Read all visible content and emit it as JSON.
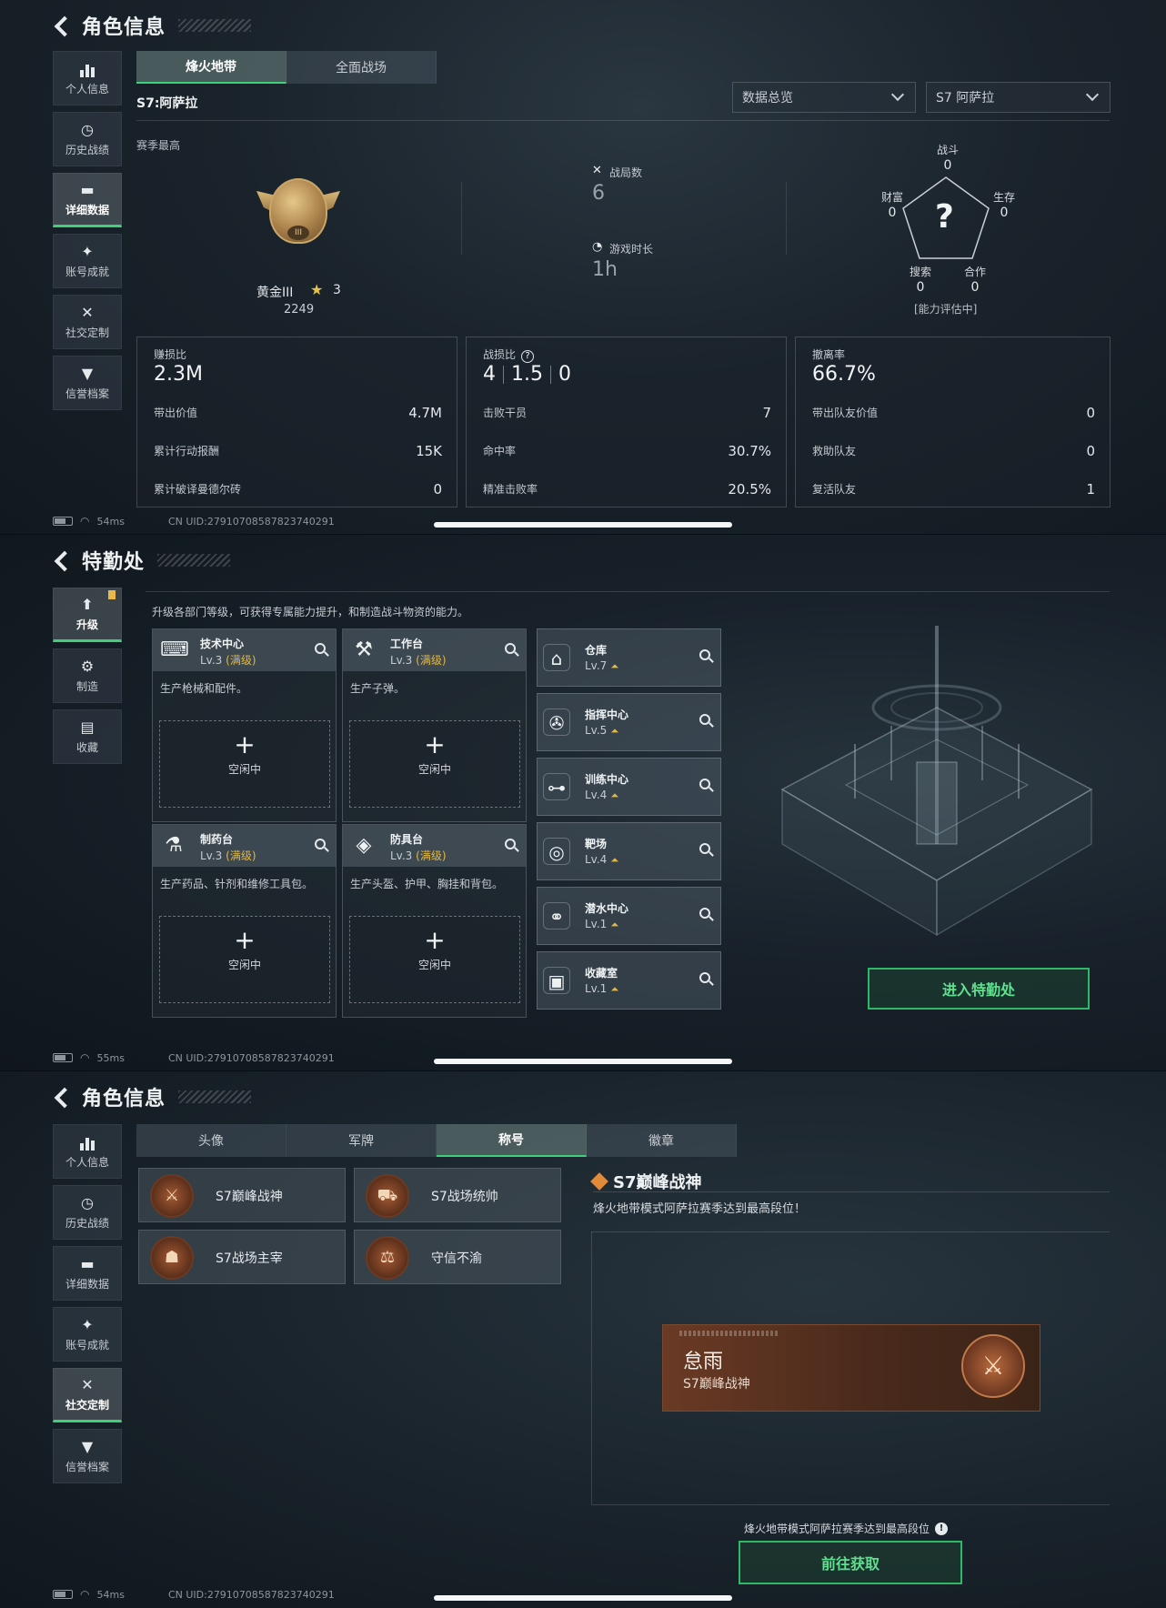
{
  "panel1": {
    "header_title": "角色信息",
    "sidebar": [
      {
        "label": "个人信息",
        "icon": "bar-chart-icon",
        "active": false
      },
      {
        "label": "历史战绩",
        "icon": "clock-icon",
        "active": false
      },
      {
        "label": "详细数据",
        "icon": "folder-icon",
        "active": true
      },
      {
        "label": "账号成就",
        "icon": "badge-icon",
        "active": false
      },
      {
        "label": "社交定制",
        "icon": "tools-icon",
        "active": false
      },
      {
        "label": "信誉档案",
        "icon": "shield-icon",
        "active": false
      }
    ],
    "tabs": [
      {
        "label": "烽火地带",
        "active": true
      },
      {
        "label": "全面战场",
        "active": false
      }
    ],
    "season_label": "S7:阿萨拉",
    "dropdowns": {
      "overview": "数据总览",
      "season": "S7 阿萨拉"
    },
    "season_best_label": "赛季最高",
    "rank": {
      "name": "黄金III",
      "stars": "3",
      "score": "2249"
    },
    "matches": {
      "label": "战局数",
      "value": "6"
    },
    "playtime": {
      "label": "游戏时长",
      "value": "1h"
    },
    "radar": {
      "combat": {
        "label": "战斗",
        "value": "0"
      },
      "survival": {
        "label": "生存",
        "value": "0"
      },
      "teamwork": {
        "label": "合作",
        "value": "0"
      },
      "search": {
        "label": "搜索",
        "value": "0"
      },
      "wealth": {
        "label": "财富",
        "value": "0"
      },
      "center": "?",
      "note": "[能力评估中]"
    },
    "cards": {
      "profit": {
        "title": "赚损比",
        "value": "2.3M",
        "rows": [
          [
            "带出价值",
            "4.7M"
          ],
          [
            "累计行动报酬",
            "15K"
          ],
          [
            "累计破译曼德尔砖",
            "0"
          ]
        ]
      },
      "kd": {
        "title": "战损比",
        "help": "?",
        "values": [
          "4",
          "1.5",
          "0"
        ],
        "rows": [
          [
            "击败干员",
            "7"
          ],
          [
            "命中率",
            "30.7%"
          ],
          [
            "精准击败率",
            "20.5%"
          ]
        ]
      },
      "extract": {
        "title": "撤离率",
        "value": "66.7%",
        "rows": [
          [
            "带出队友价值",
            "0"
          ],
          [
            "救助队友",
            "0"
          ],
          [
            "复活队友",
            "1"
          ]
        ]
      }
    },
    "footer": {
      "ping": "54ms",
      "uid": "CN UID:27910708587823740291"
    }
  },
  "panel2": {
    "header_title": "特勤处",
    "sidebar": [
      {
        "label": "升级",
        "icon": "upgrade-icon",
        "active": true
      },
      {
        "label": "制造",
        "icon": "gears-icon",
        "active": false
      },
      {
        "label": "收藏",
        "icon": "archive-icon",
        "active": false
      }
    ],
    "intro": "升级各部门等级，可获得专属能力提升，和制造战斗物资的能力。",
    "facilities": [
      {
        "name": "技术中心",
        "lv": "Lv.3",
        "max": "(满级)",
        "desc": "生产枪械和配件。",
        "slot": "空闲中",
        "icon": "⌨"
      },
      {
        "name": "工作台",
        "lv": "Lv.3",
        "max": "(满级)",
        "desc": "生产子弹。",
        "slot": "空闲中",
        "icon": "⚒"
      },
      {
        "name": "制药台",
        "lv": "Lv.3",
        "max": "(满级)",
        "desc": "生产药品、针剂和维修工具包。",
        "slot": "空闲中",
        "icon": "⚗"
      },
      {
        "name": "防具台",
        "lv": "Lv.3",
        "max": "(满级)",
        "desc": "生产头盔、护甲、胸挂和背包。",
        "slot": "空闲中",
        "icon": "◈"
      }
    ],
    "rooms": [
      {
        "name": "仓库",
        "lv": "Lv.7",
        "icon": "⌂"
      },
      {
        "name": "指挥中心",
        "lv": "Lv.5",
        "icon": "✇"
      },
      {
        "name": "训练中心",
        "lv": "Lv.4",
        "icon": "⊶"
      },
      {
        "name": "靶场",
        "lv": "Lv.4",
        "icon": "◎"
      },
      {
        "name": "潜水中心",
        "lv": "Lv.1",
        "icon": "⚭"
      },
      {
        "name": "收藏室",
        "lv": "Lv.1",
        "icon": "▣"
      }
    ],
    "enter_button": "进入特勤处",
    "footer": {
      "ping": "55ms",
      "uid": "CN UID:27910708587823740291"
    }
  },
  "panel3": {
    "header_title": "角色信息",
    "sidebar": [
      {
        "label": "个人信息",
        "icon": "bar-chart-icon",
        "active": false
      },
      {
        "label": "历史战绩",
        "icon": "clock-icon",
        "active": false
      },
      {
        "label": "详细数据",
        "icon": "folder-icon",
        "active": false
      },
      {
        "label": "账号成就",
        "icon": "badge-icon",
        "active": false
      },
      {
        "label": "社交定制",
        "icon": "tools-icon",
        "active": true
      },
      {
        "label": "信誉档案",
        "icon": "shield-icon",
        "active": false
      }
    ],
    "tabs": [
      {
        "label": "头像",
        "active": false
      },
      {
        "label": "军牌",
        "active": false
      },
      {
        "label": "称号",
        "active": true
      },
      {
        "label": "徽章",
        "active": false
      }
    ],
    "titles": [
      {
        "name": "S7巅峰战神",
        "icon": "rifle-emblem-icon"
      },
      {
        "name": "S7战场统帅",
        "icon": "vehicle-emblem-icon"
      },
      {
        "name": "S7战场主宰",
        "icon": "warrior-emblem-icon"
      },
      {
        "name": "守信不渝",
        "icon": "scales-emblem-icon"
      }
    ],
    "detail": {
      "title": "S7巅峰战神",
      "desc": "烽火地带模式阿萨拉赛季达到最高段位！",
      "player_name": "怠雨",
      "plate_title": "S7巅峰战神",
      "obtain_desc": "烽火地带模式阿萨拉赛季达到最高段位",
      "obtain_button": "前往获取"
    },
    "footer": {
      "ping": "54ms",
      "uid": "CN UID:27910708587823740291"
    }
  }
}
